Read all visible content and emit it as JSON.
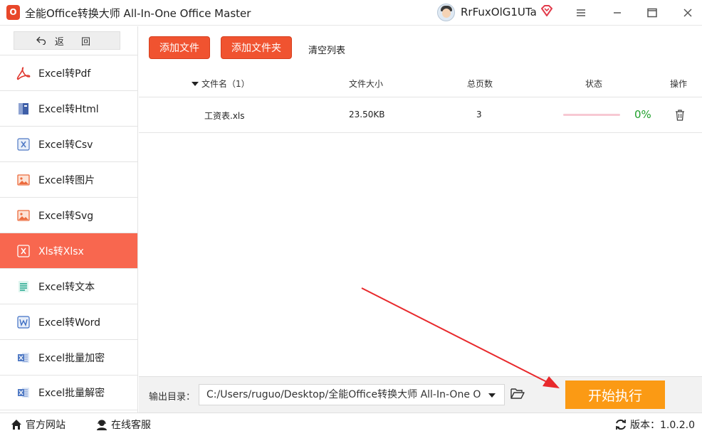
{
  "window": {
    "logo_text": "O",
    "title": "全能Office转换大师 All-In-One Office Master",
    "username": "RrFuxOlG1UTa"
  },
  "sidebar": {
    "back_label": "返 回",
    "items": [
      {
        "label": "Excel转Pdf",
        "icon": "pdf-icon"
      },
      {
        "label": "Excel转Html",
        "icon": "html-icon"
      },
      {
        "label": "Excel转Csv",
        "icon": "csv-icon"
      },
      {
        "label": "Excel转图片",
        "icon": "image-icon"
      },
      {
        "label": "Excel转Svg",
        "icon": "svg-image-icon"
      },
      {
        "label": "Xls转Xlsx",
        "icon": "xls-icon",
        "active": true
      },
      {
        "label": "Excel转文本",
        "icon": "text-icon"
      },
      {
        "label": "Excel转Word",
        "icon": "word-icon"
      },
      {
        "label": "Excel批量加密",
        "icon": "excel-lock-icon"
      },
      {
        "label": "Excel批量解密",
        "icon": "excel-unlock-icon"
      }
    ]
  },
  "toolbar": {
    "add_file": "添加文件",
    "add_folder": "添加文件夹",
    "clear_list": "清空列表"
  },
  "table": {
    "headers": {
      "filename": "文件名（1）",
      "filesize": "文件大小",
      "pages": "总页数",
      "status": "状态",
      "actions": "操作"
    },
    "rows": [
      {
        "filename": "工资表.xls",
        "filesize": "23.50KB",
        "pages": "3",
        "progress": 0,
        "percent": "0%"
      }
    ]
  },
  "output": {
    "label": "输出目录：",
    "path": "C:/Users/ruguo/Desktop/全能Office转换大师 All-In-One Office Master",
    "start_label": "开始执行"
  },
  "statusbar": {
    "website": "官方网站",
    "support": "在线客服",
    "version": "版本：1.0.2.0"
  },
  "colors": {
    "accent": "#f05330",
    "active_nav": "#f8674f",
    "start_button": "#fb9a14",
    "success": "#1fa02b",
    "arrow": "#e8292c"
  }
}
